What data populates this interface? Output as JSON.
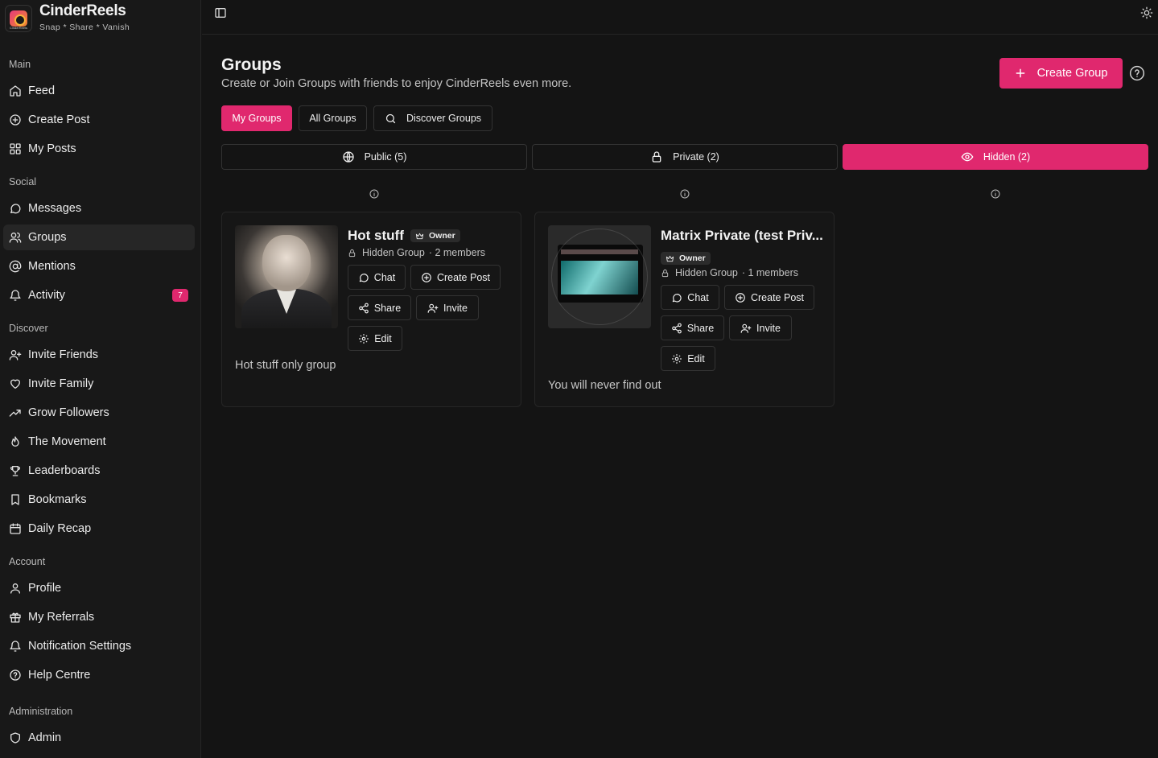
{
  "app": {
    "name": "CinderReels",
    "tagline": "Snap * Share * Vanish",
    "logo_text": "CinderReels"
  },
  "sidebar": {
    "sections": {
      "main": "Main",
      "social": "Social",
      "discover": "Discover",
      "account": "Account",
      "administration": "Administration"
    },
    "items": {
      "feed": "Feed",
      "create_post": "Create Post",
      "my_posts": "My Posts",
      "messages": "Messages",
      "groups": "Groups",
      "mentions": "Mentions",
      "activity": "Activity",
      "activity_badge": "7",
      "invite_friends": "Invite Friends",
      "invite_family": "Invite Family",
      "grow_followers": "Grow Followers",
      "the_movement": "The Movement",
      "leaderboards": "Leaderboards",
      "bookmarks": "Bookmarks",
      "daily_recap": "Daily Recap",
      "profile": "Profile",
      "my_referrals": "My Referrals",
      "notification_settings": "Notification Settings",
      "help_centre": "Help Centre",
      "admin": "Admin"
    },
    "active_item": "groups"
  },
  "header": {
    "title": "Groups",
    "subtitle": "Create or Join Groups with friends to enjoy CinderReels even more.",
    "create_button": "Create Group"
  },
  "tabs": {
    "my_groups": "My Groups",
    "all_groups": "All Groups",
    "discover_groups": "Discover Groups",
    "active": "my_groups"
  },
  "visibility_tabs": {
    "public": "Public (5)",
    "private": "Private (2)",
    "hidden": "Hidden (2)",
    "active": "hidden"
  },
  "groups": [
    {
      "title": "Hot stuff",
      "role": "Owner",
      "visibility": "Hidden Group",
      "members": "· 2 members",
      "description": "Hot stuff only group",
      "actions": {
        "chat": "Chat",
        "create_post": "Create Post",
        "share": "Share",
        "invite": "Invite",
        "edit": "Edit"
      }
    },
    {
      "title": "Matrix Private (test Priv...",
      "role": "Owner",
      "visibility": "Hidden Group",
      "members": "· 1 members",
      "description": "You will never find out",
      "actions": {
        "chat": "Chat",
        "create_post": "Create Post",
        "share": "Share",
        "invite": "Invite",
        "edit": "Edit"
      }
    }
  ],
  "colors": {
    "accent": "#e0286e",
    "background": "#141414",
    "sidebar": "#181818"
  }
}
